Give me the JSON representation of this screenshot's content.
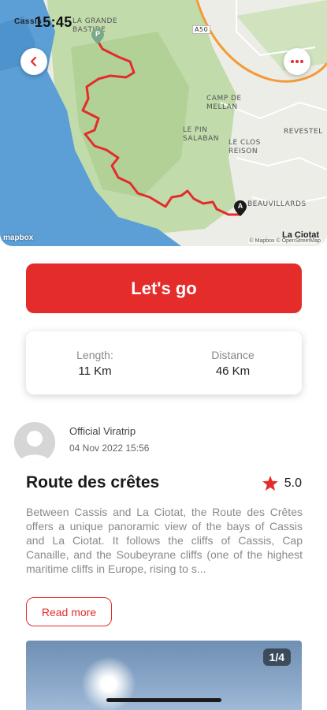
{
  "status_bar": {
    "time": "15:45"
  },
  "map": {
    "labels": {
      "cassis": "Cassis",
      "la_grande_bastide": "LA GRANDE BASTIDE",
      "a50": "A50",
      "camp_de_mellan": "CAMP DE MELLAN",
      "le_pin_salaban": "LE PIN SALABAN",
      "le_clos_reison": "LE CLOS REISON",
      "le_revestel": "REVESTEL",
      "beauvillards": "BEAUVILLARDS",
      "la_ciotat": "La Ciotat"
    },
    "start_marker": "P",
    "end_marker": "A",
    "mapbox_logo": "mapbox",
    "attribution": "© Mapbox © OpenStreetMap",
    "route_color": "#e42c2b",
    "sea_color": "#5b9fd6",
    "hills_color": "#bcd8a4"
  },
  "actions": {
    "go_label": "Let's go"
  },
  "stats": {
    "length_label": "Length:",
    "length_value": "11 Km",
    "distance_label": "Distance",
    "distance_value": "46 Km"
  },
  "author": {
    "name": "Official Viratrip",
    "date": "04 Nov 2022 15:56"
  },
  "route": {
    "title": "Route des crêtes",
    "rating": "5.0",
    "description": "Between Cassis and La Ciotat, the Route des Crêtes offers a unique panoramic view of the bays of Cassis and La Ciotat. It follows the cliffs of Cassis, Cap Canaille, and the Soubeyrane cliffs (one of the highest maritime cliffs in Europe, rising to s...",
    "read_more_label": "Read more"
  },
  "gallery": {
    "counter": "1/4"
  },
  "colors": {
    "accent": "#e42c2b"
  }
}
